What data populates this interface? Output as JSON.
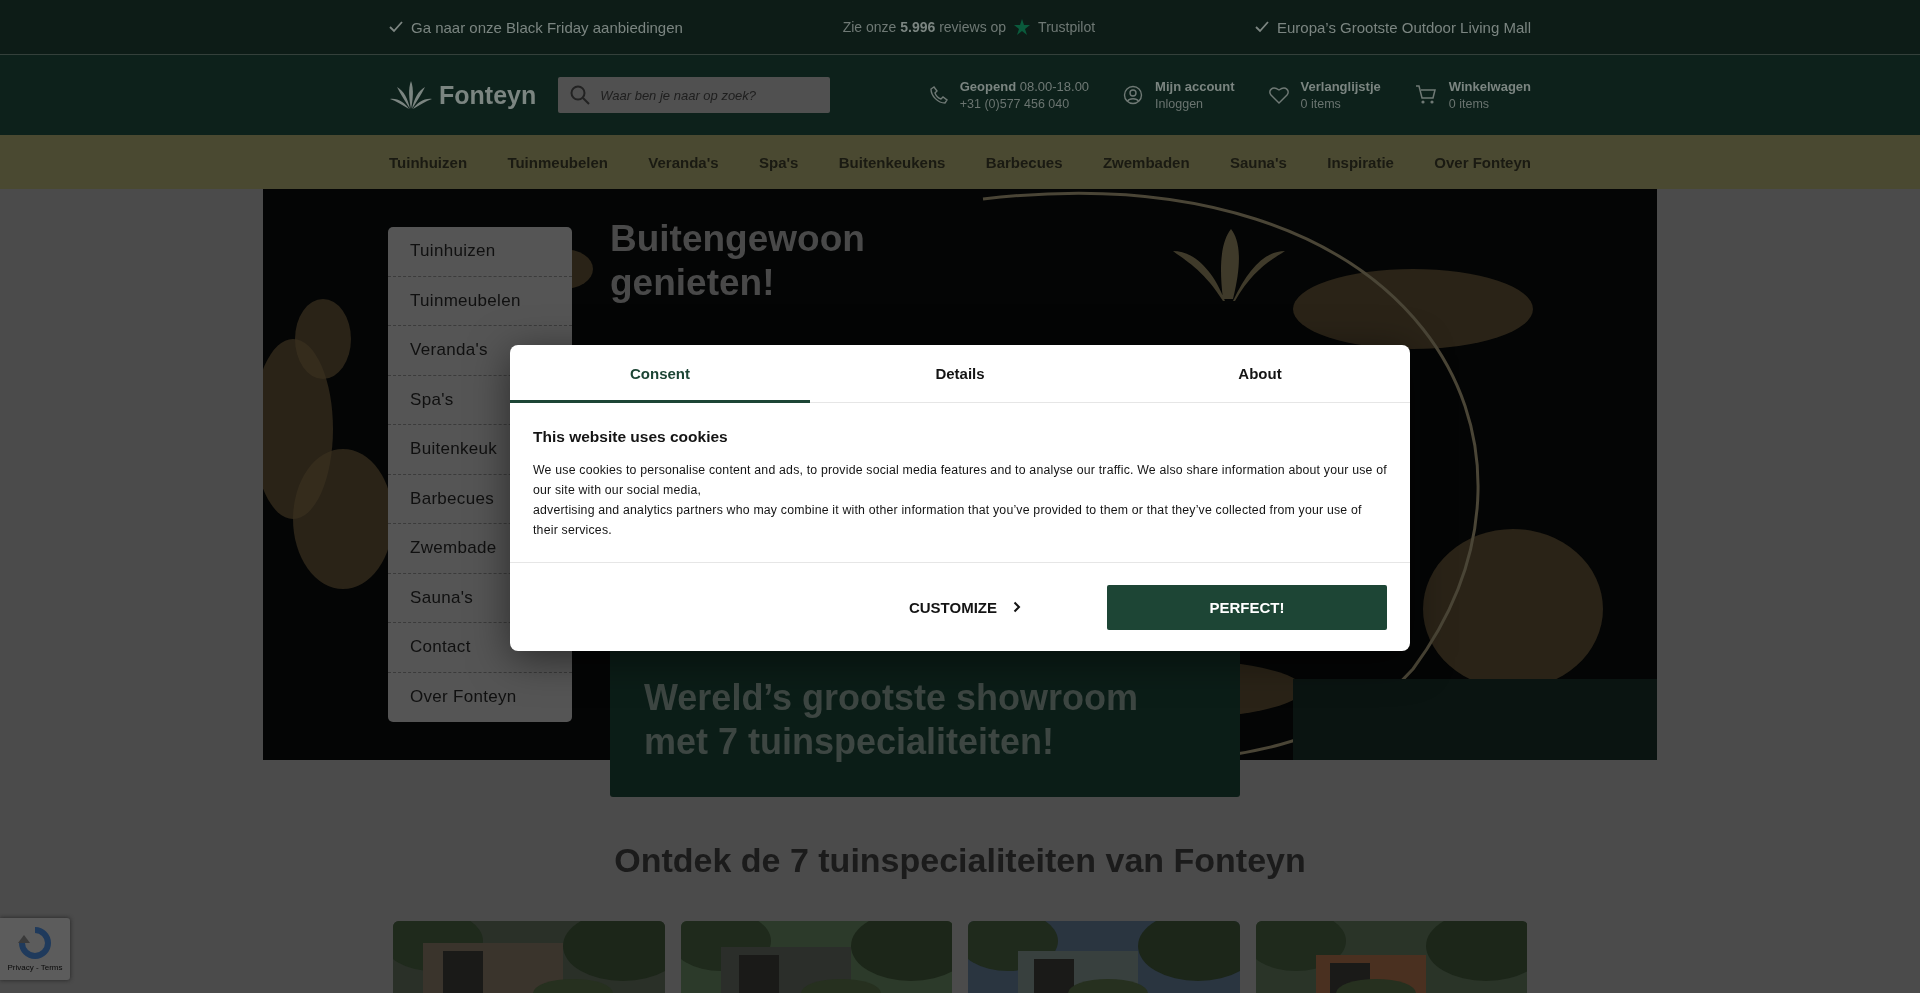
{
  "top_bar": {
    "left": "Ga naar onze Black Friday aanbiedingen",
    "reviews": "Zie onze **5.996** reviews op",
    "reviews_brand": "Trustpilot",
    "right": "Europa’s Grootste Outdoor Living Mall"
  },
  "header": {
    "logo": "Fonteyn",
    "search": {
      "placeholder": "Waar ben je naar op zoek?"
    },
    "links": [
      {
        "kind": "phone",
        "title": "Geopend",
        "extra": "08.00-18.00",
        "sub": "+31 (0)577 456 040"
      },
      {
        "kind": "account",
        "title": "Mijn account",
        "sub": "Inloggen"
      },
      {
        "kind": "wishlist",
        "title": "Verlanglijstje",
        "sub": "0 items"
      },
      {
        "kind": "cart",
        "title": "Winkelwagen",
        "sub": "0 items"
      }
    ]
  },
  "nav": [
    "Tuinhuizen",
    "Tuinmeubelen",
    "Veranda's",
    "Spa's",
    "Buitenkeukens",
    "Barbecues",
    "Zwembaden",
    "Sauna's",
    "Inspiratie",
    "Over Fonteyn"
  ],
  "hero": {
    "sidebar": [
      "Tuinhuizen",
      "Tuinmeubelen",
      "Veranda's",
      "Spa's",
      "Buitenkeuk",
      "Barbecues",
      "Zwembade",
      "Sauna's",
      "Contact",
      "Over Fonteyn"
    ],
    "heading": "Buitengewoon genieten!",
    "tagline": "Wereld’s grootste showroom met 7 tuinspecialiteiten!"
  },
  "section_title": "Ontdek de 7 tuinspecialiteiten van Fonteyn",
  "recaptcha": {
    "text": "Privacy - Terms"
  },
  "cookie_dialog": {
    "tabs": [
      {
        "label": "Consent",
        "selected": true
      },
      {
        "label": "Details",
        "selected": false
      },
      {
        "label": "About",
        "selected": false
      }
    ],
    "title": "This website uses cookies",
    "body": [
      "We use cookies to personalise content and ads, to provide social media features and to analyse our traffic. We also share information about your use of our site with our social media,",
      "advertising and analytics partners who may combine it with other information that you’ve provided to them or that they’ve collected from your use of their services."
    ],
    "customize": "CUSTOMIZE",
    "accept": "PERFECT!"
  }
}
